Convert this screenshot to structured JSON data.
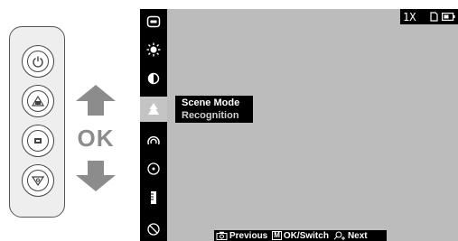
{
  "remote": {
    "buttons": [
      "power",
      "camera",
      "menu",
      "zoom"
    ],
    "ok_label": "OK"
  },
  "sidebar": {
    "items": [
      {
        "icon": "menu-icon",
        "selected": false
      },
      {
        "icon": "brightness-icon",
        "selected": false
      },
      {
        "icon": "contrast-icon",
        "selected": false
      },
      {
        "icon": "scene-mode-icon",
        "selected": true
      },
      {
        "icon": "hotspot-icon",
        "selected": false
      },
      {
        "icon": "crosshair-icon",
        "selected": false
      },
      {
        "icon": "bar-icon",
        "selected": false
      },
      {
        "icon": "disable-icon",
        "selected": false
      }
    ]
  },
  "popup": {
    "title": "Scene Mode",
    "subtitle": "Recognition"
  },
  "status": {
    "zoom": "1X"
  },
  "help": {
    "previous": "Previous",
    "m_key": "M",
    "ok_switch": "OK/Switch",
    "next": "Next"
  },
  "colors": {
    "screen": "#bcbcbc",
    "bars": "#000000",
    "selected": "#c4c4c4",
    "arrow": "#8c8c8c"
  }
}
